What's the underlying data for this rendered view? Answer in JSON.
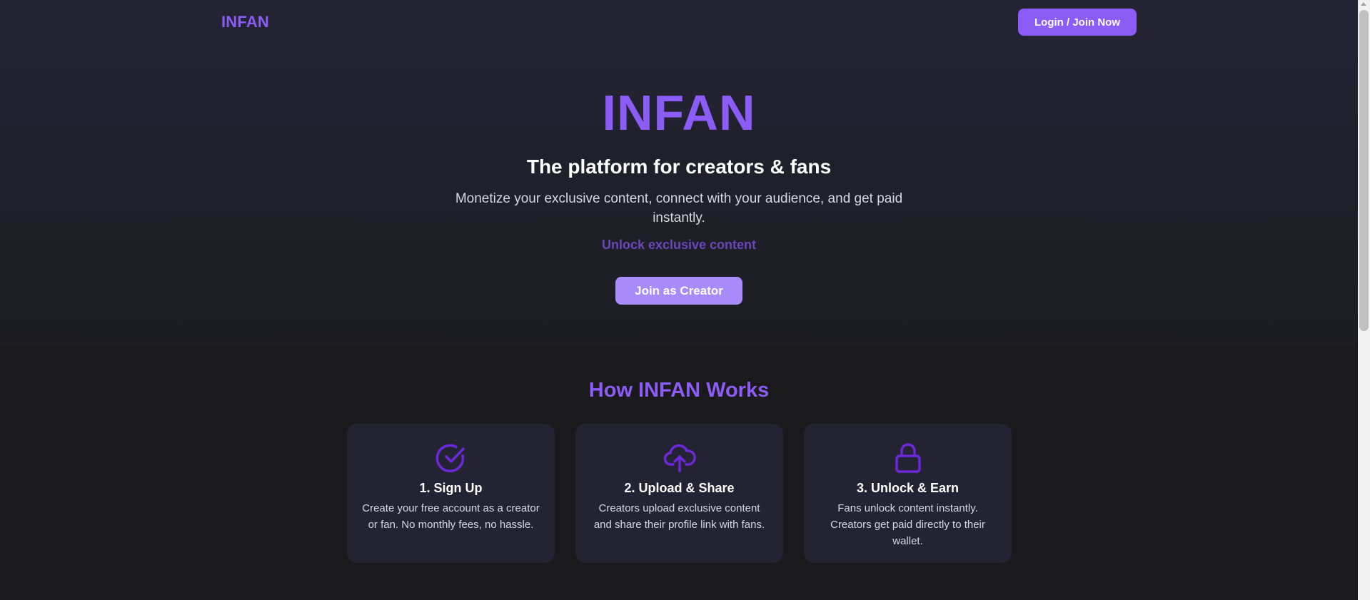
{
  "header": {
    "logo": "INFAN",
    "login_label": "Login / Join Now"
  },
  "hero": {
    "title": "INFAN",
    "subtitle": "The platform for creators & fans",
    "description": "Monetize your exclusive content, connect with your audience, and get paid instantly.",
    "tagline": "Unlock exclusive content",
    "cta_label": "Join as Creator"
  },
  "how": {
    "title": "How INFAN Works",
    "cards": [
      {
        "icon": "check-circle-icon",
        "title": "1. Sign Up",
        "text": "Create your free account as a creator or fan. No monthly fees, no hassle."
      },
      {
        "icon": "cloud-upload-icon",
        "title": "2. Upload & Share",
        "text": "Creators upload exclusive content and share their profile link with fans."
      },
      {
        "icon": "lock-icon",
        "title": "3. Unlock & Earn",
        "text": "Fans unlock content instantly. Creators get paid directly to their wallet."
      }
    ]
  },
  "colors": {
    "accent": "#8b5cf6",
    "accent_light": "#a78bfa",
    "icon": "#6d28d9",
    "header_bg": "#232334",
    "page_bg": "#1a1a1c",
    "card_bg": "#232334"
  }
}
